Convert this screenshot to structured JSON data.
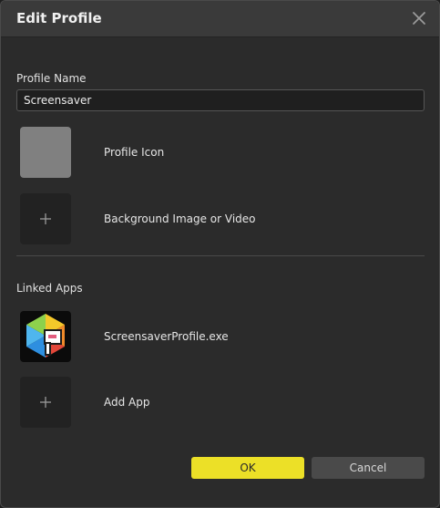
{
  "dialog": {
    "title": "Edit Profile",
    "close_icon": "close-icon"
  },
  "profile_name": {
    "label": "Profile Name",
    "value": "Screensaver"
  },
  "profile_icon": {
    "label": "Profile Icon",
    "color": "#808080"
  },
  "background": {
    "label": "Background Image or Video",
    "icon": "plus-icon"
  },
  "linked_apps": {
    "label": "Linked Apps",
    "apps": [
      {
        "name": "ScreensaverProfile.exe",
        "icon": "screensaver-profile-app-icon"
      }
    ],
    "add_label": "Add App"
  },
  "buttons": {
    "ok_label": "OK",
    "cancel_label": "Cancel"
  },
  "colors": {
    "accent": "#ece027",
    "dialog_bg": "#2b2b2b",
    "titlebar_bg": "#3a3a3a"
  }
}
